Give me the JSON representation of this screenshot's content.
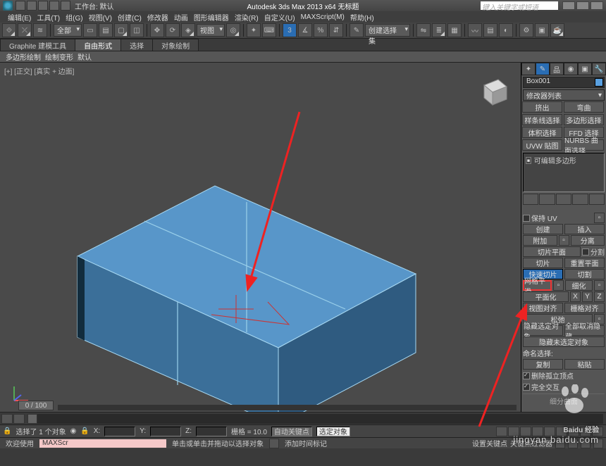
{
  "title_bar": {
    "workspace_label": "工作台: 默认",
    "app_title": "Autodesk 3ds Max  2013 x64   无标题",
    "search_placeholder": "键入关键字或短语"
  },
  "menu": [
    "编辑(E)",
    "工具(T)",
    "组(G)",
    "视图(V)",
    "创建(C)",
    "修改器",
    "动画",
    "图形编辑器",
    "渲染(R)",
    "自定义(U)",
    "MAXScript(M)",
    "帮助(H)"
  ],
  "tb1": {
    "sel_combo": "全部",
    "view_combo": "视图",
    "create_combo": "创建选择集"
  },
  "ribbon": {
    "tabs": [
      "Graphite 建模工具",
      "自由形式",
      "选择",
      "对象绘制"
    ],
    "sub": [
      "多边形绘制",
      "绘制变形",
      "默认"
    ]
  },
  "viewport": {
    "label": "[+] [正交] [真实 + 边面]",
    "scrub": "0 / 100"
  },
  "cmd": {
    "obj_name": "Box001",
    "mod_list": "修改器列表",
    "mod_btns": [
      "挤出",
      "弯曲",
      "样条线选择",
      "多边形选择",
      "体积选择",
      "FFD 选择",
      "UVW 贴图",
      "NURBS 曲面选择"
    ],
    "stack_item": "可编辑多边形",
    "keep_uv": "保持 UV",
    "row_create": [
      "创建",
      "插入"
    ],
    "row_attach": [
      "附加",
      "分离"
    ],
    "row_slice_plane": [
      "切片平面",
      "分割"
    ],
    "row_slice": [
      "切片",
      "重置平面"
    ],
    "row_quick": [
      "快速切片",
      "切割"
    ],
    "row_msmooth": [
      "网格平滑",
      "细化"
    ],
    "row_planar": [
      "平面化",
      "X",
      "Y",
      "Z"
    ],
    "row_viewalign": [
      "视图对齐",
      "栅格对齐"
    ],
    "row_relax": "松弛",
    "row_hide": [
      "隐藏选定对象",
      "全部取消隐藏"
    ],
    "row_hide_unsel": "隐藏未选定对象",
    "named_sel": "命名选择:",
    "row_copy": [
      "复制",
      "粘贴"
    ],
    "del_iso": "删除孤立顶点",
    "full_inter": "完全交互",
    "subdiv": "细分曲面"
  },
  "status": {
    "sel_msg": "选择了 1 个对象",
    "x": "X:",
    "y": "Y:",
    "z": "Z:",
    "grid": "栅格 = 10.0",
    "autokey": "自动关键点",
    "selkey": "选定对象"
  },
  "status2": {
    "welcome": "欢迎使用",
    "script": "MAXScr",
    "prompt": "单击或单击并拖动以选择对象",
    "keybtn": "设置关键点",
    "filter": "关键点过滤器",
    "addtime": "添加时间标记"
  },
  "watermark": {
    "brand": "Baidu 经验",
    "url": "jingyan.baidu.com"
  }
}
